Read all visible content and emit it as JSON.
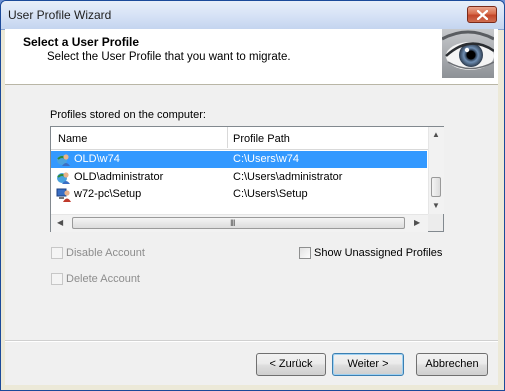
{
  "window": {
    "title": "User Profile Wizard"
  },
  "header": {
    "title": "Select a User Profile",
    "subtitle": "Select the User Profile that you want to migrate."
  },
  "profiles": {
    "label": "Profiles stored on the computer:",
    "columns": [
      "Name",
      "Profile Path"
    ],
    "rows": [
      {
        "name": "OLD\\w74",
        "path": "C:\\Users\\w74",
        "icon": "domain-user-icon",
        "selected": true
      },
      {
        "name": "OLD\\administrator",
        "path": "C:\\Users\\administrator",
        "icon": "domain-user-icon",
        "selected": false
      },
      {
        "name": "w72-pc\\Setup",
        "path": "C:\\Users\\Setup",
        "icon": "local-user-icon",
        "selected": false
      }
    ],
    "hscroll_grip": "III"
  },
  "options": {
    "disable_account": "Disable Account",
    "delete_account": "Delete Account",
    "show_unassigned": "Show Unassigned Profiles"
  },
  "buttons": {
    "back": "< Zurück",
    "next": "Weiter >",
    "cancel": "Abbrechen"
  },
  "colors": {
    "selection": "#3399ff",
    "title_bar": "#d7e3f6",
    "dialog_bg": "#f0f0f0"
  }
}
